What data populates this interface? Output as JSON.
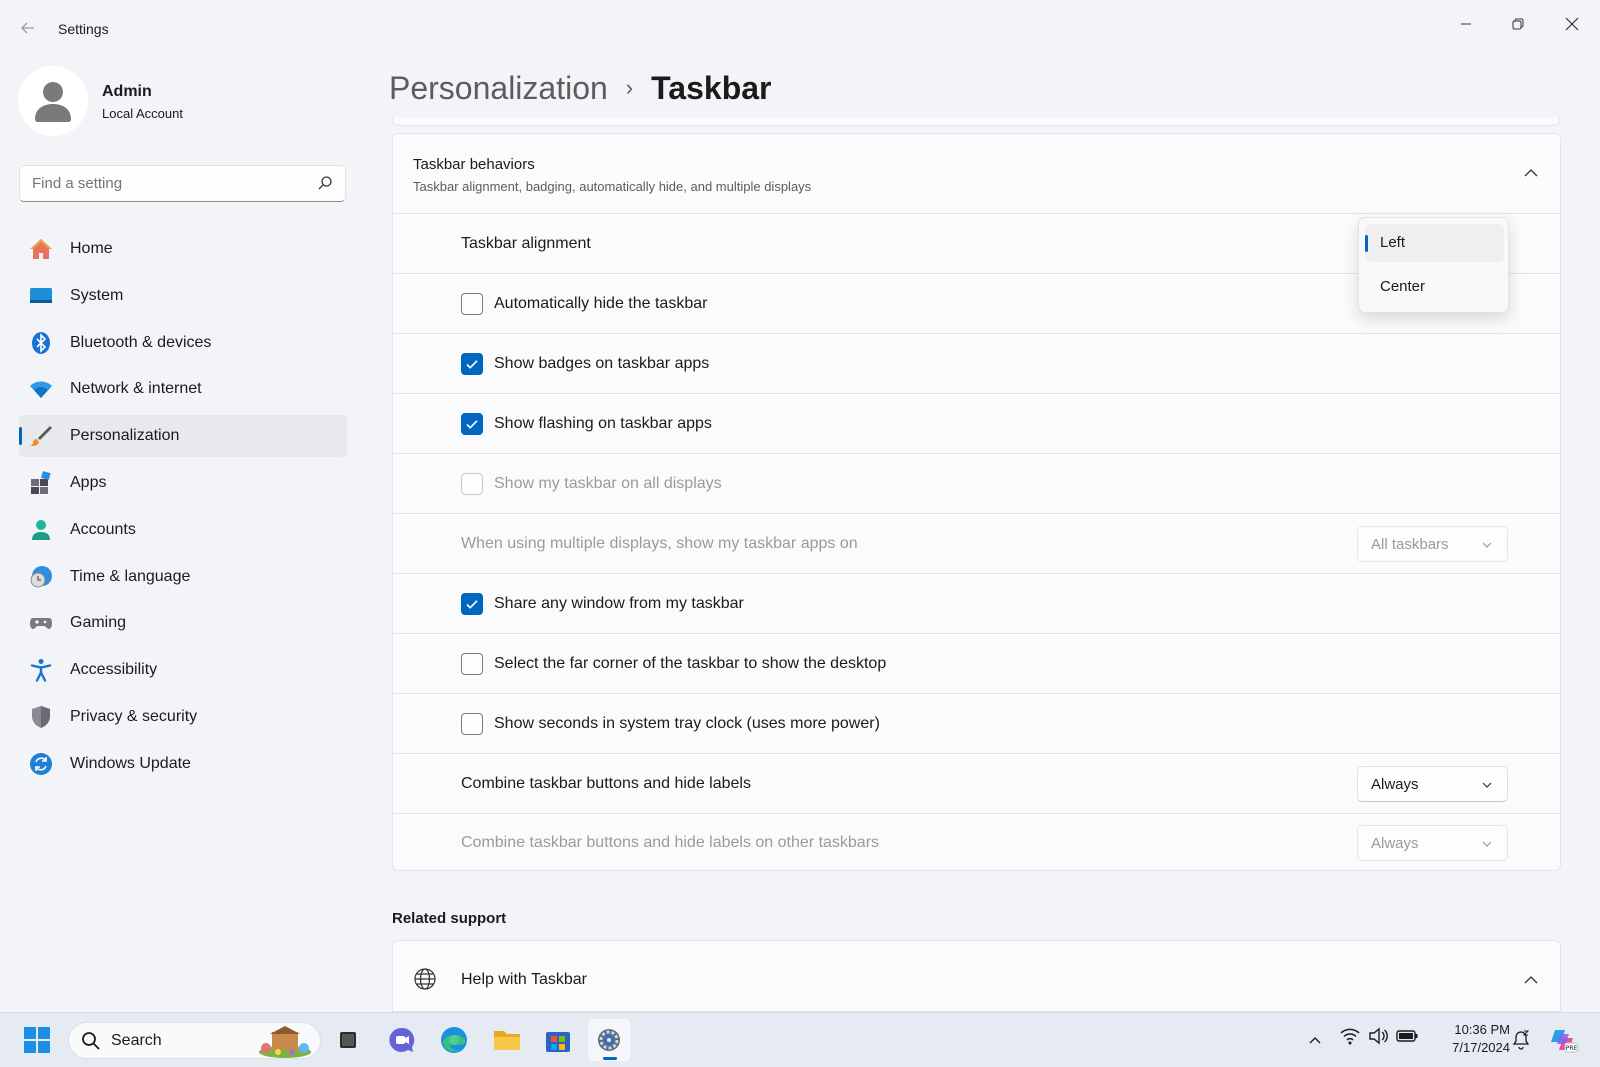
{
  "window": {
    "title": "Settings",
    "back_icon": "back-arrow-icon"
  },
  "profile": {
    "name": "Admin",
    "account_type": "Local Account"
  },
  "search": {
    "placeholder": "Find a setting"
  },
  "sidebar": {
    "items": [
      {
        "label": "Home",
        "icon": "home-icon"
      },
      {
        "label": "System",
        "icon": "system-icon"
      },
      {
        "label": "Bluetooth & devices",
        "icon": "bluetooth-icon"
      },
      {
        "label": "Network & internet",
        "icon": "wifi-icon"
      },
      {
        "label": "Personalization",
        "icon": "paintbrush-icon",
        "active": true
      },
      {
        "label": "Apps",
        "icon": "apps-icon"
      },
      {
        "label": "Accounts",
        "icon": "accounts-icon"
      },
      {
        "label": "Time & language",
        "icon": "time-language-icon"
      },
      {
        "label": "Gaming",
        "icon": "gaming-icon"
      },
      {
        "label": "Accessibility",
        "icon": "accessibility-icon"
      },
      {
        "label": "Privacy & security",
        "icon": "shield-icon"
      },
      {
        "label": "Windows Update",
        "icon": "windows-update-icon"
      }
    ]
  },
  "breadcrumb": {
    "parent": "Personalization",
    "separator": "›",
    "current": "Taskbar"
  },
  "behaviors": {
    "title": "Taskbar behaviors",
    "subtitle": "Taskbar alignment, badging, automatically hide, and multiple displays",
    "rows": [
      {
        "label": "Taskbar alignment",
        "type": "dropdown-open"
      },
      {
        "label": "Automatically hide the taskbar",
        "type": "checkbox",
        "checked": false
      },
      {
        "label": "Show badges on taskbar apps",
        "type": "checkbox",
        "checked": true
      },
      {
        "label": "Show flashing on taskbar apps",
        "type": "checkbox",
        "checked": true
      },
      {
        "label": "Show my taskbar on all displays",
        "type": "checkbox",
        "checked": false,
        "disabled": true
      },
      {
        "label": "When using multiple displays, show my taskbar apps on",
        "type": "dropdown",
        "value": "All taskbars",
        "disabled": true
      },
      {
        "label": "Share any window from my taskbar",
        "type": "checkbox",
        "checked": true
      },
      {
        "label": "Select the far corner of the taskbar to show the desktop",
        "type": "checkbox",
        "checked": false
      },
      {
        "label": "Show seconds in system tray clock (uses more power)",
        "type": "checkbox",
        "checked": false
      },
      {
        "label": "Combine taskbar buttons and hide labels",
        "type": "dropdown",
        "value": "Always"
      },
      {
        "label": "Combine taskbar buttons and hide labels on other taskbars",
        "type": "dropdown",
        "value": "Always",
        "disabled": true
      }
    ]
  },
  "alignment_popup": {
    "options": [
      "Left",
      "Center"
    ],
    "selected": "Left"
  },
  "related": {
    "title": "Related support",
    "help_label": "Help with Taskbar"
  },
  "taskbar": {
    "search_label": "Search",
    "time": "10:36 PM",
    "date": "7/17/2024"
  },
  "colors": {
    "accent": "#0067c0",
    "background": "#f3f4f8",
    "card": "#fbfbfd"
  }
}
